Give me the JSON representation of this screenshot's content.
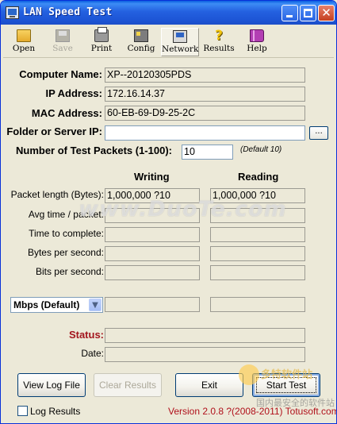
{
  "window": {
    "title": "LAN Speed Test",
    "colors": {
      "title_bar": "#2461e0",
      "status_label": "#a3151d",
      "version_text": "#b0101b"
    }
  },
  "toolbar": {
    "items": [
      {
        "label": "Open",
        "icon": "open-folder-icon",
        "enabled": true
      },
      {
        "label": "Save",
        "icon": "save-disk-icon",
        "enabled": false
      },
      {
        "label": "Print",
        "icon": "printer-icon",
        "enabled": true
      },
      {
        "label": "Config",
        "icon": "config-icon",
        "enabled": true
      },
      {
        "label": "Network",
        "icon": "network-icon",
        "enabled": true,
        "selected": true
      },
      {
        "label": "Results",
        "icon": "question-mark-icon",
        "enabled": true
      },
      {
        "label": "Help",
        "icon": "help-book-icon",
        "enabled": true
      }
    ]
  },
  "info": {
    "computer_name_label": "Computer Name:",
    "computer_name": "XP--20120305PDS",
    "ip_label": "IP Address:",
    "ip": "172.16.14.37",
    "mac_label": "MAC Address:",
    "mac": "60-EB-69-D9-25-2C",
    "folder_label": "Folder or Server IP:",
    "folder_value": "",
    "browse_label": "...",
    "packets_label": "Number of Test Packets (1-100):",
    "packets_value": "10",
    "packets_default": "(Default 10)"
  },
  "results": {
    "writing_header": "Writing",
    "reading_header": "Reading",
    "rows": [
      {
        "label": "Packet length (Bytes):",
        "writing": "1,000,000 ?10",
        "reading": "1,000,000 ?10"
      },
      {
        "label": "Avg time / packet:",
        "writing": "",
        "reading": ""
      },
      {
        "label": "Time to complete:",
        "writing": "",
        "reading": ""
      },
      {
        "label": "Bytes per second:",
        "writing": "",
        "reading": ""
      },
      {
        "label": "Bits per second:",
        "writing": "",
        "reading": ""
      }
    ],
    "unit_select": "Mbps (Default)",
    "unit_writing": "",
    "unit_reading": ""
  },
  "status": {
    "status_label": "Status:",
    "status_value": "",
    "date_label": "Date:",
    "date_value": ""
  },
  "buttons": {
    "view_log": "View Log File",
    "clear_results": "Clear Results",
    "exit": "Exit",
    "start_test": "Start Test"
  },
  "footer": {
    "log_results_label": "Log Results",
    "log_results_checked": false,
    "version": "Version 2.0.8  ?(2008-2011) Totusoft.com"
  },
  "watermark": {
    "main": "www.DuoTe.com",
    "corner_top": "多特软件站",
    "corner_bottom": "国内最安全的软件站"
  }
}
